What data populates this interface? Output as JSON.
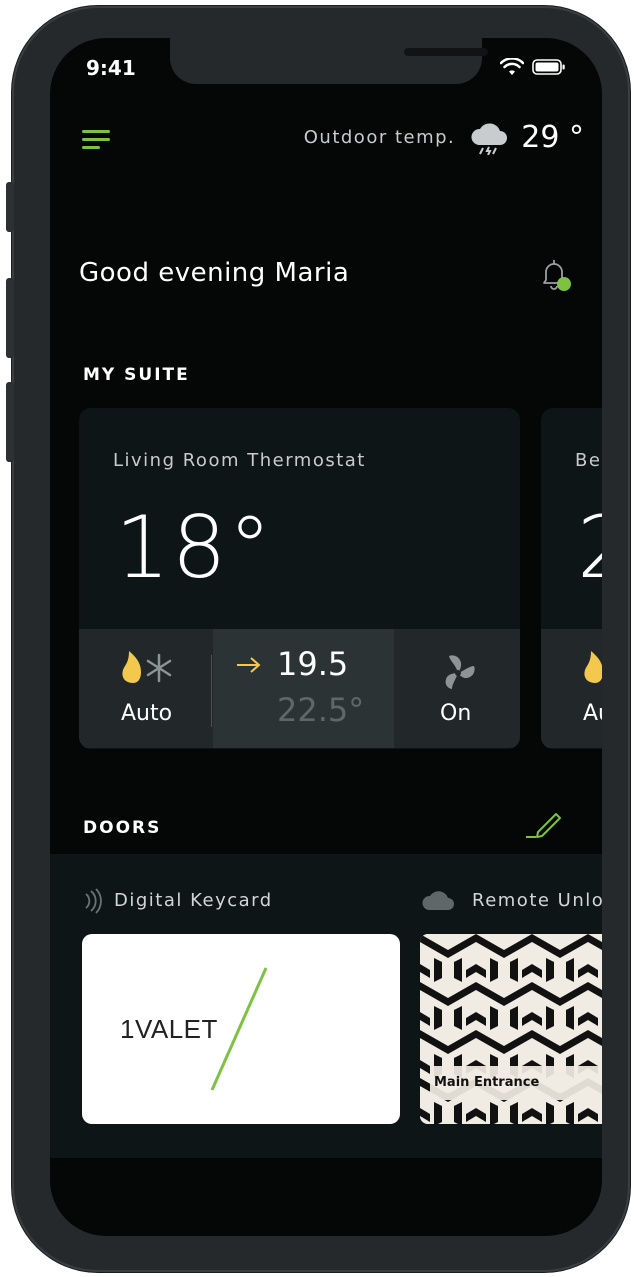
{
  "status_bar": {
    "time": "9:41"
  },
  "header": {
    "outdoor_label": "Outdoor temp.",
    "outdoor_temp": "29 °",
    "weather_icon": "storm-cloud-icon"
  },
  "greeting": "Good evening Maria",
  "notification": {
    "has_unread": true
  },
  "my_suite": {
    "title": "MY SUITE",
    "cards": [
      {
        "name": "Living Room Thermostat",
        "temperature": "18°",
        "mode_label": "Auto",
        "target_primary": "19.5",
        "target_secondary": "22.5°",
        "fan_label": "On"
      },
      {
        "name": "Be",
        "temperature": "2",
        "mode_label": "Au"
      }
    ]
  },
  "doors": {
    "title": "DOORS",
    "keycard_label": "Digital Keycard",
    "remote_label": "Remote Unlo",
    "keycard_logo": "1VALET",
    "entrance_label": "Main Entrance"
  },
  "colors": {
    "accent_green": "#7dc242",
    "flame_yellow": "#f2c94c",
    "background": "#050606",
    "card": "#0d1517"
  }
}
